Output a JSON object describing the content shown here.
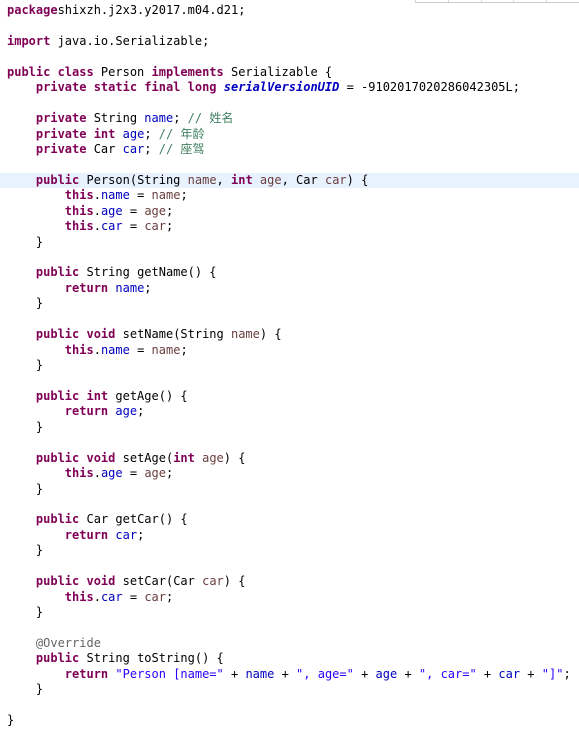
{
  "editor": {
    "current_line": 11,
    "lines": [
      [
        [
          "kw",
          "package"
        ],
        [
          "",
          "shixzh.j2x3.y2017.m04.d21;"
        ]
      ],
      [],
      [
        [
          "kw",
          "import"
        ],
        [
          "",
          " java.io.Serializable;"
        ]
      ],
      [],
      [
        [
          "kw",
          "public class"
        ],
        [
          "",
          " Person "
        ],
        [
          "kw",
          "implements"
        ],
        [
          "",
          " Serializable {"
        ]
      ],
      [
        [
          "",
          "    "
        ],
        [
          "kw",
          "private static final long"
        ],
        [
          "",
          " "
        ],
        [
          "sfield",
          "serialVersionUID"
        ],
        [
          "",
          " = -9102017020286042305L;"
        ]
      ],
      [],
      [
        [
          "",
          "    "
        ],
        [
          "kw",
          "private"
        ],
        [
          "",
          " String "
        ],
        [
          "field",
          "name"
        ],
        [
          "",
          "; "
        ],
        [
          "cmt",
          "// 姓名"
        ]
      ],
      [
        [
          "",
          "    "
        ],
        [
          "kw",
          "private int"
        ],
        [
          "",
          " "
        ],
        [
          "field",
          "age"
        ],
        [
          "",
          "; "
        ],
        [
          "cmt",
          "// 年龄"
        ]
      ],
      [
        [
          "",
          "    "
        ],
        [
          "kw",
          "private"
        ],
        [
          "",
          " Car "
        ],
        [
          "field",
          "car"
        ],
        [
          "",
          "; "
        ],
        [
          "cmt",
          "// 座驾"
        ]
      ],
      [],
      [
        [
          "",
          "    "
        ],
        [
          "kw",
          "public"
        ],
        [
          "",
          " Person(String "
        ],
        [
          "param",
          "name"
        ],
        [
          "",
          ", "
        ],
        [
          "kw",
          "int"
        ],
        [
          "",
          " "
        ],
        [
          "param",
          "age"
        ],
        [
          "",
          ", Car "
        ],
        [
          "param",
          "car"
        ],
        [
          "",
          ") {"
        ]
      ],
      [
        [
          "",
          "        "
        ],
        [
          "kw",
          "this"
        ],
        [
          "",
          "."
        ],
        [
          "field",
          "name"
        ],
        [
          "",
          " = "
        ],
        [
          "param",
          "name"
        ],
        [
          "",
          ";"
        ]
      ],
      [
        [
          "",
          "        "
        ],
        [
          "kw",
          "this"
        ],
        [
          "",
          "."
        ],
        [
          "field",
          "age"
        ],
        [
          "",
          " = "
        ],
        [
          "param",
          "age"
        ],
        [
          "",
          ";"
        ]
      ],
      [
        [
          "",
          "        "
        ],
        [
          "kw",
          "this"
        ],
        [
          "",
          "."
        ],
        [
          "field",
          "car"
        ],
        [
          "",
          " = "
        ],
        [
          "param",
          "car"
        ],
        [
          "",
          ";"
        ]
      ],
      [
        [
          "",
          "    }"
        ]
      ],
      [],
      [
        [
          "",
          "    "
        ],
        [
          "kw",
          "public"
        ],
        [
          "",
          " String getName() {"
        ]
      ],
      [
        [
          "",
          "        "
        ],
        [
          "kw",
          "return"
        ],
        [
          "",
          " "
        ],
        [
          "field",
          "name"
        ],
        [
          "",
          ";"
        ]
      ],
      [
        [
          "",
          "    }"
        ]
      ],
      [],
      [
        [
          "",
          "    "
        ],
        [
          "kw",
          "public void"
        ],
        [
          "",
          " setName(String "
        ],
        [
          "param",
          "name"
        ],
        [
          "",
          ") {"
        ]
      ],
      [
        [
          "",
          "        "
        ],
        [
          "kw",
          "this"
        ],
        [
          "",
          "."
        ],
        [
          "field",
          "name"
        ],
        [
          "",
          " = "
        ],
        [
          "param",
          "name"
        ],
        [
          "",
          ";"
        ]
      ],
      [
        [
          "",
          "    }"
        ]
      ],
      [],
      [
        [
          "",
          "    "
        ],
        [
          "kw",
          "public int"
        ],
        [
          "",
          " getAge() {"
        ]
      ],
      [
        [
          "",
          "        "
        ],
        [
          "kw",
          "return"
        ],
        [
          "",
          " "
        ],
        [
          "field",
          "age"
        ],
        [
          "",
          ";"
        ]
      ],
      [
        [
          "",
          "    }"
        ]
      ],
      [],
      [
        [
          "",
          "    "
        ],
        [
          "kw",
          "public void"
        ],
        [
          "",
          " setAge("
        ],
        [
          "kw",
          "int"
        ],
        [
          "",
          " "
        ],
        [
          "param",
          "age"
        ],
        [
          "",
          ") {"
        ]
      ],
      [
        [
          "",
          "        "
        ],
        [
          "kw",
          "this"
        ],
        [
          "",
          "."
        ],
        [
          "field",
          "age"
        ],
        [
          "",
          " = "
        ],
        [
          "param",
          "age"
        ],
        [
          "",
          ";"
        ]
      ],
      [
        [
          "",
          "    }"
        ]
      ],
      [],
      [
        [
          "",
          "    "
        ],
        [
          "kw",
          "public"
        ],
        [
          "",
          " Car getCar() {"
        ]
      ],
      [
        [
          "",
          "        "
        ],
        [
          "kw",
          "return"
        ],
        [
          "",
          " "
        ],
        [
          "field",
          "car"
        ],
        [
          "",
          ";"
        ]
      ],
      [
        [
          "",
          "    }"
        ]
      ],
      [],
      [
        [
          "",
          "    "
        ],
        [
          "kw",
          "public void"
        ],
        [
          "",
          " setCar(Car "
        ],
        [
          "param",
          "car"
        ],
        [
          "",
          ") {"
        ]
      ],
      [
        [
          "",
          "        "
        ],
        [
          "kw",
          "this"
        ],
        [
          "",
          "."
        ],
        [
          "field",
          "car"
        ],
        [
          "",
          " = "
        ],
        [
          "param",
          "car"
        ],
        [
          "",
          ";"
        ]
      ],
      [
        [
          "",
          "    }"
        ]
      ],
      [],
      [
        [
          "",
          "    "
        ],
        [
          "ann",
          "@Override"
        ]
      ],
      [
        [
          "",
          "    "
        ],
        [
          "kw",
          "public"
        ],
        [
          "",
          " String toString() {"
        ]
      ],
      [
        [
          "",
          "        "
        ],
        [
          "kw",
          "return"
        ],
        [
          "",
          " "
        ],
        [
          "str",
          "\"Person [name=\""
        ],
        [
          "",
          " + "
        ],
        [
          "field",
          "name"
        ],
        [
          "",
          " + "
        ],
        [
          "str",
          "\", age=\""
        ],
        [
          "",
          " + "
        ],
        [
          "field",
          "age"
        ],
        [
          "",
          " + "
        ],
        [
          "str",
          "\", car=\""
        ],
        [
          "",
          " + "
        ],
        [
          "field",
          "car"
        ],
        [
          "",
          " + "
        ],
        [
          "str",
          "\"]\""
        ],
        [
          "",
          ";"
        ]
      ],
      [
        [
          "",
          "    }"
        ]
      ],
      [],
      [
        [
          "",
          "}"
        ]
      ]
    ]
  }
}
